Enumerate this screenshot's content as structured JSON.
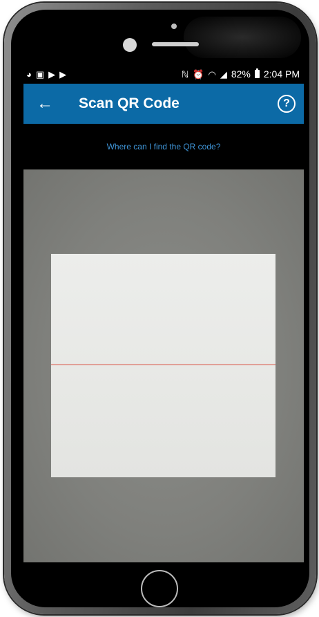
{
  "status_bar": {
    "icons_left": [
      "messenger-icon",
      "gallery-icon",
      "flag-icon",
      "flag-icon"
    ],
    "icons_right": [
      "nfc-icon",
      "alarm-icon",
      "wifi-icon",
      "lte-signal-icon"
    ],
    "battery_text": "82%",
    "time": "2:04 PM"
  },
  "app_bar": {
    "title": "Scan QR Code",
    "back_icon": "arrow-left-icon",
    "help_icon": "help-circle-icon",
    "help_glyph": "?",
    "color": "#0c6aa6"
  },
  "help_link": {
    "label": "Where can I find the QR code?",
    "color": "#3f95d8"
  },
  "scanner": {
    "line_color": "#d84a3a"
  }
}
